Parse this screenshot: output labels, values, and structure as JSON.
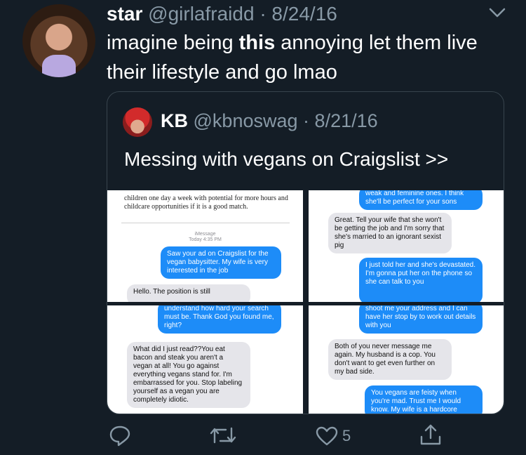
{
  "tweet": {
    "name": "star",
    "handle": "@girlafraidd",
    "separator": "·",
    "date": "8/24/16",
    "text_before": "imagine being ",
    "text_bold": "this",
    "text_after": " annoying let them live their lifestyle and go lmao"
  },
  "quoted": {
    "name": "KB",
    "handle": "@kbnoswag",
    "separator": "·",
    "date": "8/21/16",
    "text": "Messing with vegans on Craigslist >>"
  },
  "screenshots": {
    "p1": {
      "doc_text": "children one day a week with potential for more hours and childcare opportunities if it is a good match.",
      "imessage_label": "iMessage",
      "imessage_time": "Today 4:35 PM",
      "msg1": "Saw your ad on Craigslist for the vegan babysitter. My wife is very interested in the job",
      "msg2": "Hello. The position is still"
    },
    "p2": {
      "msg1": "weak and feminine ones. I think she'll be perfect for your sons",
      "msg2": "Great. Tell your wife that she won't be getting the job and I'm sorry that she's married to an ignorant sexist pig",
      "msg3": "I just told her and she's devastated. I'm gonna put her on the phone so she can talk to you"
    },
    "p3": {
      "msg1": "understand how hard your search must be. Thank God you found me, right?",
      "msg2": "What did I just read??You eat bacon and steak you aren't a vegan at all! You go against everything vegans stand for. I'm embarrassed for you. Stop labeling yourself as a vegan you are completely idiotic."
    },
    "p4": {
      "msg1": "shoot me your address and I can have her stop by to work out details with you",
      "msg2": "Both of you never message me again. My husband is a cop. You don't want to get even further on my bad side.",
      "msg3": "You vegans are feisty when you're mad. Trust me I would know. My wife is a hardcore"
    }
  },
  "actions": {
    "reply_icon": "reply-icon",
    "retweet_icon": "retweet-icon",
    "like_icon": "heart-icon",
    "like_count": "5",
    "share_icon": "share-icon"
  },
  "colors": {
    "background": "#141d26",
    "secondary_text": "#8899a6",
    "imessage_blue": "#1d8cf8",
    "imessage_gray": "#e5e5ea"
  }
}
